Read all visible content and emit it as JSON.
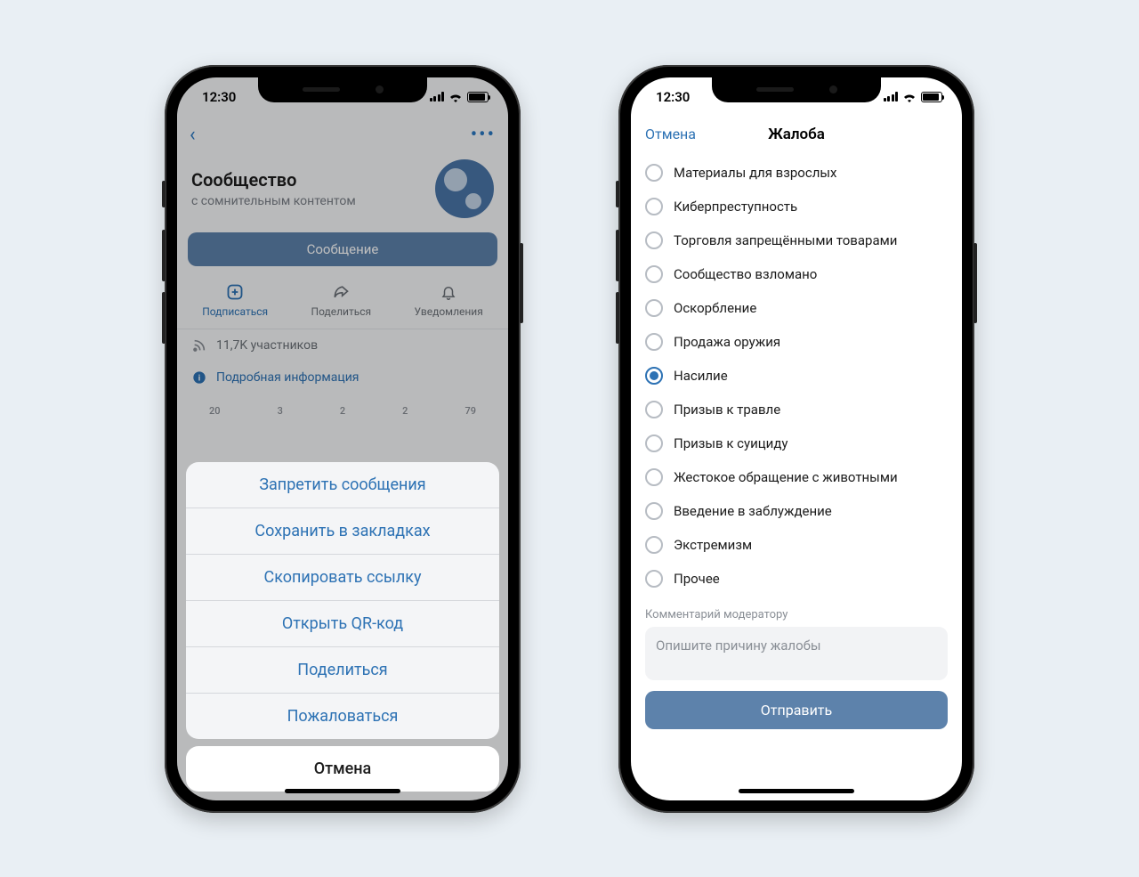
{
  "status_time": "12:30",
  "phone1": {
    "profile": {
      "title": "Сообщество",
      "subtitle": "с сомнительным контентом"
    },
    "message_button": "Сообщение",
    "actions": {
      "subscribe": "Подписаться",
      "share": "Поделиться",
      "notify": "Уведомления"
    },
    "members": "11,7K участников",
    "more_info": "Подробная информация",
    "stats": [
      "20",
      "3",
      "2",
      "2",
      "79"
    ],
    "sheet": {
      "items": [
        "Запретить сообщения",
        "Сохранить в закладках",
        "Скопировать ссылку",
        "Открыть QR-код",
        "Поделиться",
        "Пожаловаться"
      ],
      "cancel": "Отмена"
    }
  },
  "phone2": {
    "cancel": "Отмена",
    "title": "Жалоба",
    "options": [
      "Материалы для взрослых",
      "Киберпреступность",
      "Торговля запрещёнными товарами",
      "Сообщество взломано",
      "Оскорбление",
      "Продажа оружия",
      "Насилие",
      "Призыв к травле",
      "Призыв к суициду",
      "Жестокое обращение с животными",
      "Введение в заблуждение",
      "Экстремизм",
      "Прочее"
    ],
    "selected_index": 6,
    "comment_label": "Комментарий модератору",
    "comment_placeholder": "Опишите причину жалобы",
    "send": "Отправить"
  }
}
